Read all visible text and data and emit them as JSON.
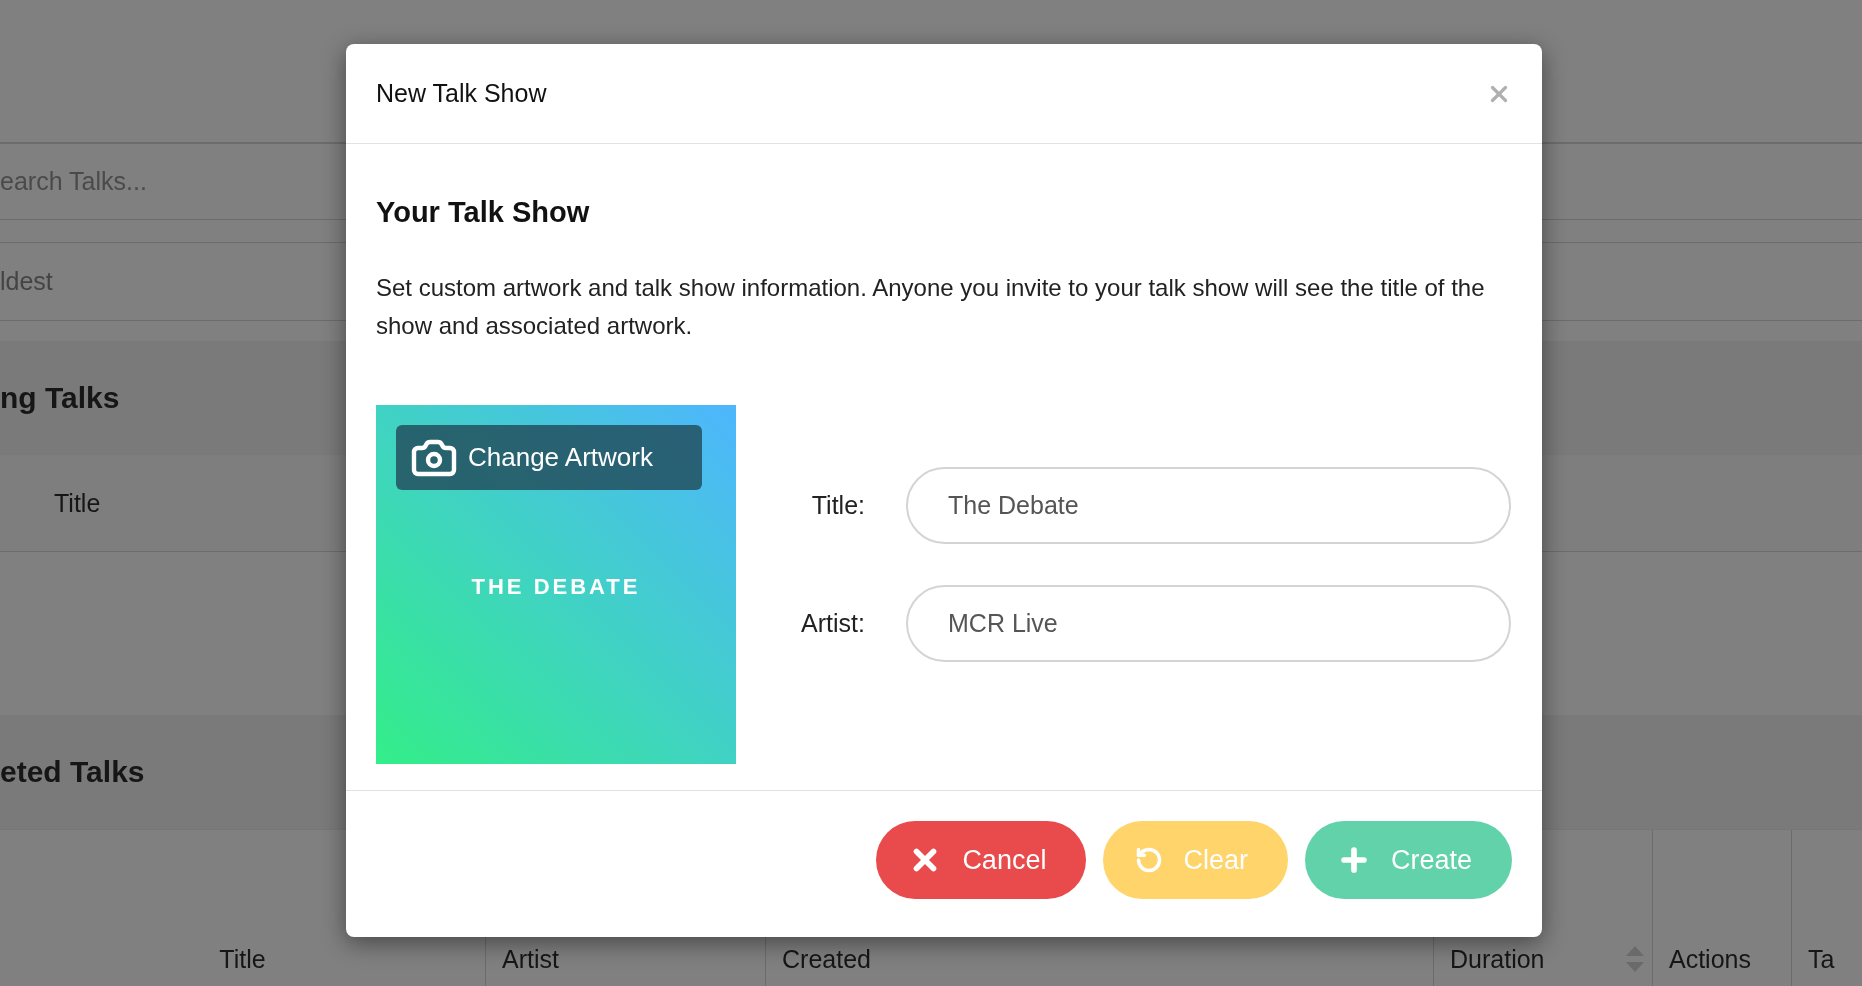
{
  "background": {
    "search_placeholder": "earch Talks...",
    "sort_value": "ldest",
    "sections": [
      {
        "title": "ng Talks",
        "columns": [
          {
            "label": "Title"
          }
        ]
      },
      {
        "title": "eted Talks",
        "columns": [
          {
            "label": "Title",
            "sortable": false
          },
          {
            "label": "Artist",
            "sortable": false
          },
          {
            "label": "Created",
            "sortable": false
          },
          {
            "label": "Duration",
            "sortable": true
          },
          {
            "label": "Actions",
            "sortable": false
          },
          {
            "label": "Ta",
            "sortable": false
          }
        ]
      }
    ]
  },
  "dialog": {
    "title": "New Talk Show",
    "section_title": "Your Talk Show",
    "description": "Set custom artwork and talk show information. Anyone you invite to your talk show will see the title of the show and associated artwork.",
    "artwork": {
      "title": "THE DEBATE",
      "button": "Change Artwork"
    },
    "fields": [
      {
        "label": "Title:",
        "value": "The Debate"
      },
      {
        "label": "Artist:",
        "value": "MCR Live"
      }
    ],
    "buttons": [
      {
        "kind": "cancel",
        "label": "Cancel"
      },
      {
        "kind": "clear",
        "label": "Clear"
      },
      {
        "kind": "create",
        "label": "Create"
      }
    ]
  }
}
